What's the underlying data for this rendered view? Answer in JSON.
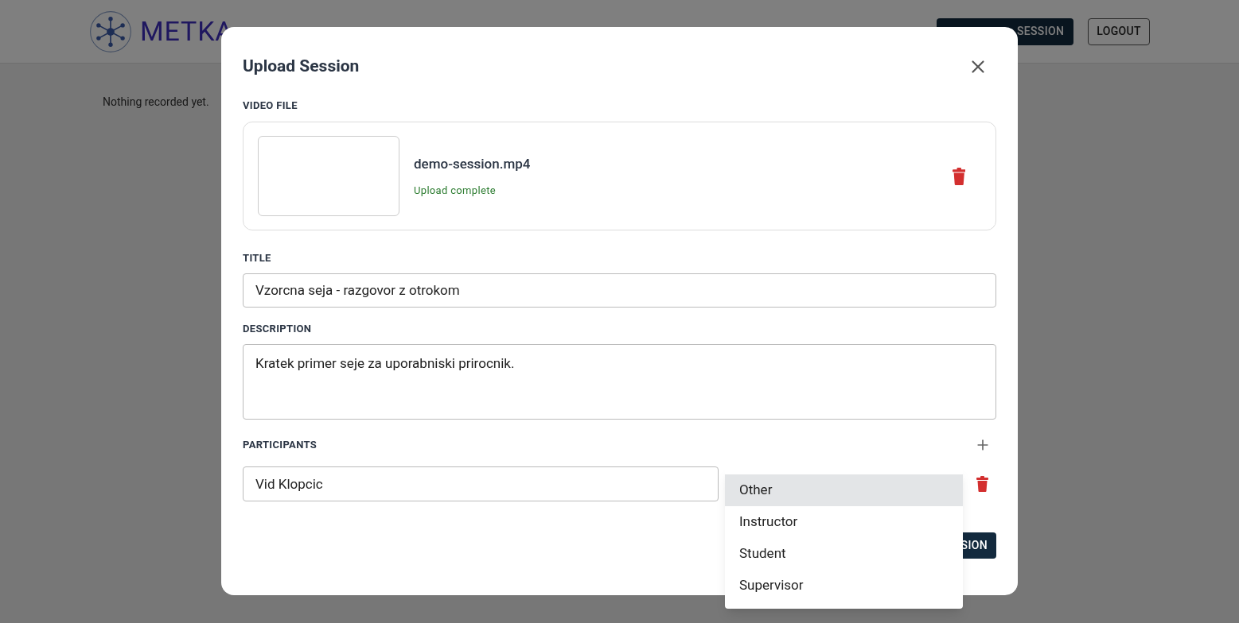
{
  "header": {
    "logo": "METKA",
    "upload_button": "SESSION",
    "logout_button": "LOGOUT"
  },
  "page": {
    "empty_message": "Nothing recorded yet."
  },
  "dialog": {
    "title": "Upload Session",
    "video": {
      "label": "VIDEO FILE",
      "file_name": "demo-session.mp4",
      "status": "Upload complete"
    },
    "title_field": {
      "label": "TITLE",
      "value": "Vzorcna seja - razgovor z otrokom"
    },
    "description_field": {
      "label": "DESCRIPTION",
      "value": "Kratek primer seje za uporabniski prirocnik."
    },
    "participants": {
      "label": "PARTICIPANTS",
      "rows": [
        {
          "name": "Vid Klopcic"
        }
      ]
    },
    "submit_button": "SION"
  },
  "role_menu": [
    {
      "label": "Other",
      "selected": true
    },
    {
      "label": "Instructor",
      "selected": false
    },
    {
      "label": "Student",
      "selected": false
    },
    {
      "label": "Supervisor",
      "selected": false
    }
  ]
}
